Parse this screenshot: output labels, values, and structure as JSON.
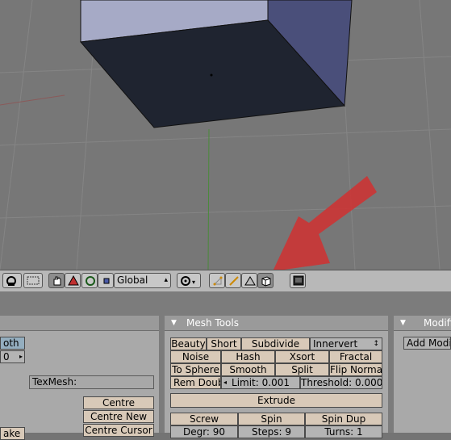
{
  "header": {
    "orientation": "Global"
  },
  "mesh_tools": {
    "title": "Mesh Tools",
    "beauty": "Beauty",
    "short": "Short",
    "subdivide": "Subdivide",
    "innervert": "Innervert",
    "noise": "Noise",
    "hash": "Hash",
    "xsort": "Xsort",
    "fractal": "Fractal",
    "to_sphere": "To Sphere",
    "smooth": "Smooth",
    "split": "Split",
    "flip_normal": "Flip Normal",
    "rem_doubl": "Rem Doubl",
    "limit": "Limit: 0.001",
    "threshold": "Threshold: 0.000",
    "extrude": "Extrude",
    "screw": "Screw",
    "spin": "Spin",
    "spin_dup": "Spin Dup",
    "degr": "Degr: 90",
    "steps": "Steps: 9",
    "turns": "Turns: 1"
  },
  "link_panel": {
    "smooth_partial": "oth",
    "value_partial": "0",
    "texmesh": "TexMesh:",
    "centre": "Centre",
    "centre_new": "Centre New",
    "centre_cursor": "Centre Cursor",
    "partial_bottom": "ake"
  },
  "modifiers": {
    "title": "Modifi",
    "add": "Add Modi"
  },
  "icons": [
    "view-rotate-icon",
    "layers-icon",
    "grab-hand-icon",
    "triangle-mode-icon",
    "proportional-icon",
    "select-square-icon",
    "pivot-icon",
    "vertex-select-icon",
    "edge-select-icon",
    "face-select-icon",
    "solid-cube-icon",
    "render-icon"
  ],
  "colors": {
    "arrow": "#d03030",
    "cube_top": "#1f2430",
    "cube_side": "#4a4f7a"
  }
}
